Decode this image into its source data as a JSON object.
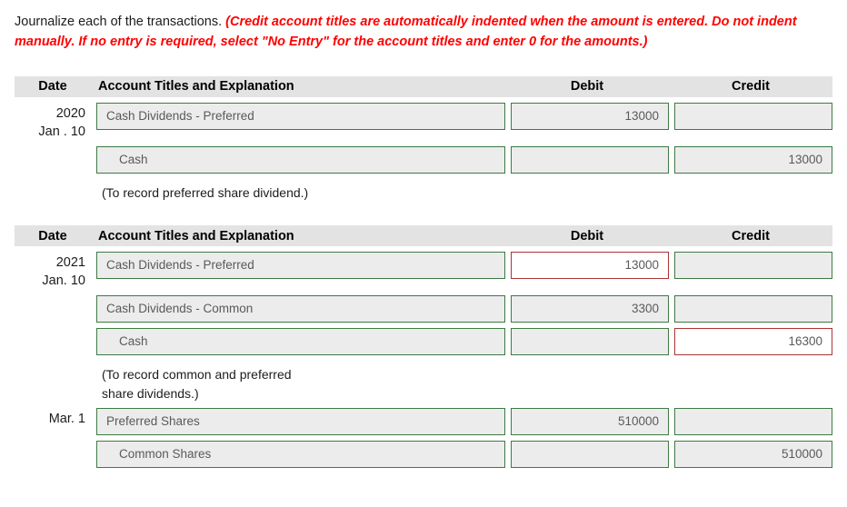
{
  "instructions": {
    "plain": "Journalize each of the transactions. ",
    "note": "(Credit account titles are automatically indented when the amount is entered. Do not indent manually. If no entry is required, select \"No Entry\" for the account titles and enter 0 for the amounts.)"
  },
  "colors": {
    "header_bar": "#e3e3e3",
    "field_border_ok": "#3d7a43",
    "field_border_error": "#ab3434",
    "field_fill": "#ececec",
    "note_text": "#ff0000"
  },
  "columns": {
    "date": "Date",
    "account": "Account Titles and Explanation",
    "debit": "Debit",
    "credit": "Credit"
  },
  "tables": [
    {
      "id": "journal-2020",
      "rows": [
        {
          "date": "2020\nJan . 10",
          "account": "Cash Dividends - Preferred",
          "account_indented": false,
          "account_state": "ok",
          "debit": "13000",
          "debit_state": "ok",
          "credit": "",
          "credit_state": "ok"
        },
        {
          "date": "",
          "account": "Cash",
          "account_indented": true,
          "account_state": "ok",
          "debit": "",
          "debit_state": "ok",
          "credit": "13000",
          "credit_state": "ok"
        }
      ],
      "explanation": "(To record preferred share dividend.)"
    },
    {
      "id": "journal-2021",
      "rows": [
        {
          "date": "2021\nJan. 10",
          "account": "Cash Dividends - Preferred",
          "account_indented": false,
          "account_state": "ok",
          "debit": "13000",
          "debit_state": "wrong",
          "credit": "",
          "credit_state": "ok"
        },
        {
          "date": "",
          "account": "Cash Dividends - Common",
          "account_indented": false,
          "account_state": "ok",
          "debit": "3300",
          "debit_state": "ok",
          "credit": "",
          "credit_state": "ok"
        },
        {
          "date": "",
          "account": "Cash",
          "account_indented": true,
          "account_state": "ok",
          "debit": "",
          "debit_state": "ok",
          "credit": "16300",
          "credit_state": "wrong"
        }
      ],
      "explanation": "(To record common and preferred\nshare dividends.)",
      "rows2": [
        {
          "date": "Mar. 1",
          "account": "Preferred Shares",
          "account_indented": false,
          "account_state": "ok",
          "debit": "510000",
          "debit_state": "ok",
          "credit": "",
          "credit_state": "ok"
        },
        {
          "date": "",
          "account": "Common Shares",
          "account_indented": true,
          "account_state": "ok",
          "debit": "",
          "debit_state": "ok",
          "credit": "510000",
          "credit_state": "ok"
        }
      ]
    }
  ]
}
